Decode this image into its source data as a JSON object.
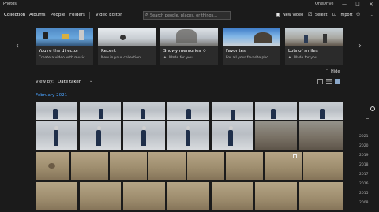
{
  "app": {
    "title": "Photos",
    "onedrive_label": "OneDrive"
  },
  "window_controls": {
    "minimize": "—",
    "maximize": "☐",
    "close": "✕"
  },
  "nav": {
    "tabs": [
      "Collection",
      "Albums",
      "People",
      "Folders",
      "Video Editor"
    ]
  },
  "search": {
    "placeholder": "Search people, places, or things..."
  },
  "toolbar": {
    "new_video": "New video",
    "select": "Select",
    "import": "Import",
    "more": "..."
  },
  "cards": [
    {
      "title": "You're the director",
      "subtitle": "Create a video with music"
    },
    {
      "title": "Recent",
      "subtitle": "New in your collection"
    },
    {
      "title": "Snowy memories",
      "subtitle": "Made for you"
    },
    {
      "title": "Favorites",
      "subtitle": "For all your favorite pho..."
    },
    {
      "title": "Lots of smiles",
      "subtitle": "Made for you"
    }
  ],
  "hide_label": "Hide",
  "view": {
    "label": "View by:",
    "value": "Date taken"
  },
  "timeline": {
    "month": "February 2021",
    "years": [
      "2021",
      "2020",
      "2019",
      "2018",
      "2017",
      "2016",
      "2015",
      "2008"
    ]
  },
  "colors": {
    "accent": "#4aa3ff",
    "background": "#1b1b1b"
  }
}
